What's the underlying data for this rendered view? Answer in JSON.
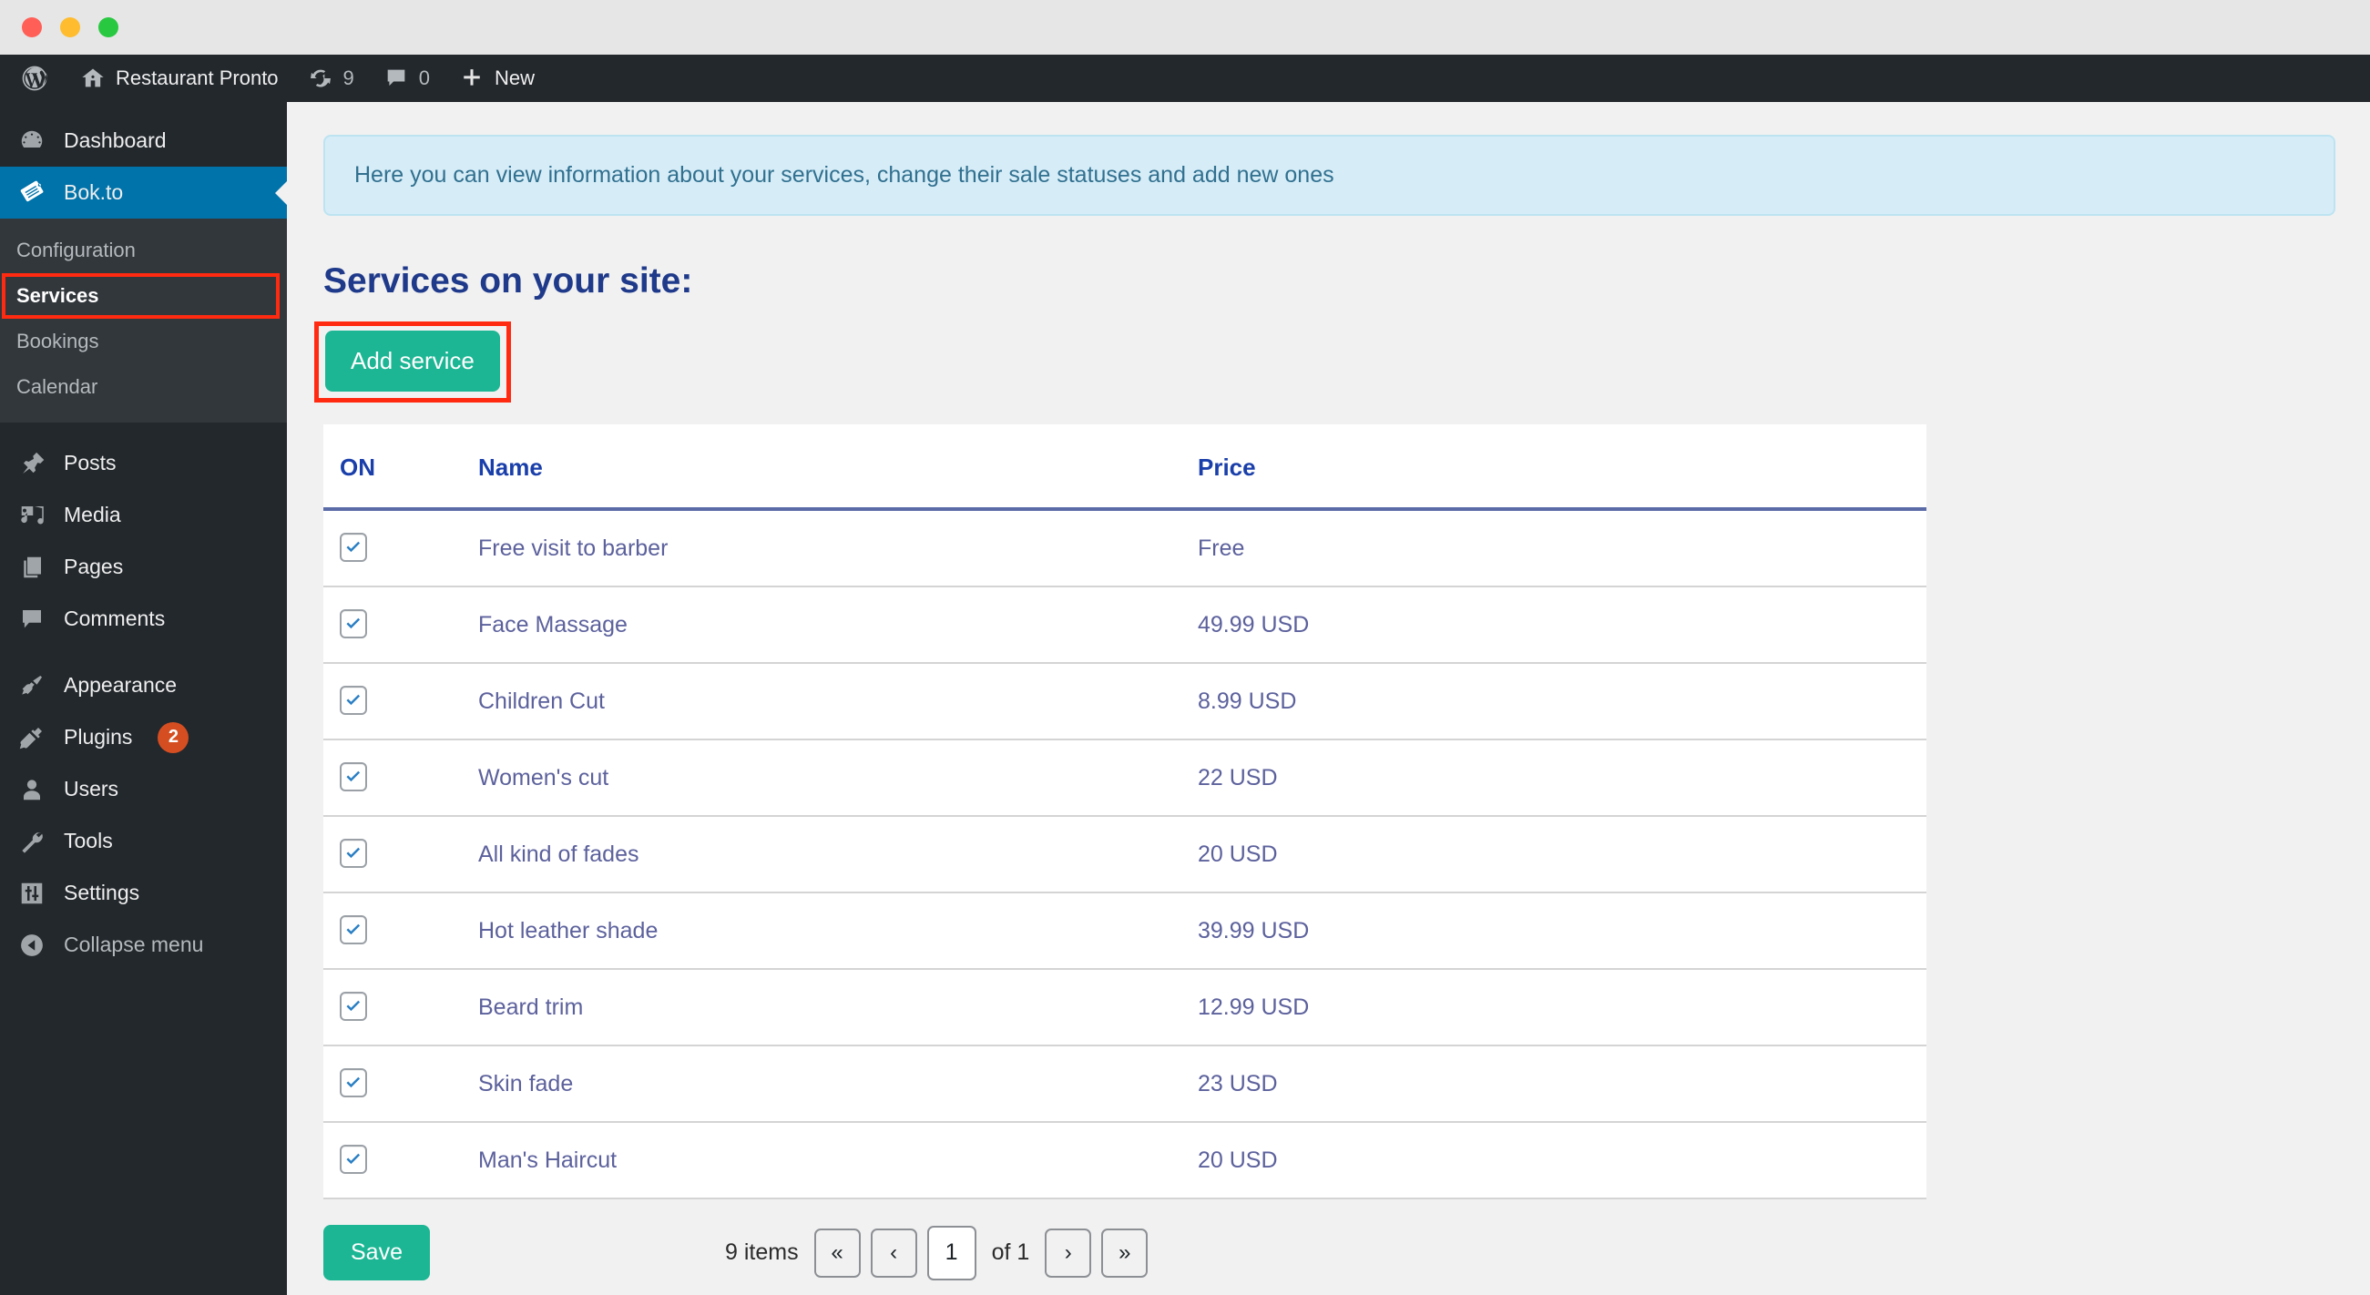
{
  "window": {
    "traffic_lights": [
      "close",
      "minimize",
      "zoom"
    ],
    "colors": {
      "close": "#ff5f57",
      "minimize": "#febc2e",
      "zoom": "#28c840"
    }
  },
  "adminbar": {
    "logo_icon": "wordpress-icon",
    "site_icon": "home-icon",
    "site_name": "Restaurant Pronto",
    "updates_icon": "updates-icon",
    "updates_count": "9",
    "comments_icon": "comment-icon",
    "comments_count": "0",
    "new_icon": "plus-icon",
    "new_label": "New"
  },
  "sidebar": {
    "items": [
      {
        "label": "Dashboard",
        "icon": "dashboard-icon",
        "active": false
      },
      {
        "label": "Bok.to",
        "icon": "bokto-tickets-icon",
        "active": true
      },
      {
        "label": "Posts",
        "icon": "pin-icon",
        "active": false
      },
      {
        "label": "Media",
        "icon": "media-icon",
        "active": false
      },
      {
        "label": "Pages",
        "icon": "pages-icon",
        "active": false
      },
      {
        "label": "Comments",
        "icon": "comment-icon",
        "active": false
      },
      {
        "label": "Appearance",
        "icon": "paintbrush-icon",
        "active": false
      },
      {
        "label": "Plugins",
        "icon": "plug-icon",
        "active": false,
        "badge": "2"
      },
      {
        "label": "Users",
        "icon": "user-icon",
        "active": false
      },
      {
        "label": "Tools",
        "icon": "wrench-icon",
        "active": false
      },
      {
        "label": "Settings",
        "icon": "sliders-icon",
        "active": false
      }
    ],
    "submenu": [
      {
        "label": "Configuration",
        "current": false,
        "highlighted": false
      },
      {
        "label": "Services",
        "current": true,
        "highlighted": true
      },
      {
        "label": "Bookings",
        "current": false,
        "highlighted": false
      },
      {
        "label": "Calendar",
        "current": false,
        "highlighted": false
      }
    ],
    "collapse": {
      "label": "Collapse menu",
      "icon": "collapse-arrow-icon"
    },
    "colors": {
      "active_bg": "#0073aa",
      "submenu_bg": "#32373c",
      "bg": "#23282d",
      "badge": "#d54e21"
    }
  },
  "main": {
    "notice": "Here you can view information about your services, change their sale statuses and add new ones",
    "page_title": "Services on your site:",
    "add_service_label": "Add service",
    "highlight_color": "#ff2a10",
    "accent_green": "#1cb694",
    "table": {
      "headers": [
        "ON",
        "Name",
        "Price"
      ],
      "rows": [
        {
          "on": true,
          "name": "Free visit to barber",
          "price": "Free"
        },
        {
          "on": true,
          "name": "Face Massage",
          "price": "49.99 USD"
        },
        {
          "on": true,
          "name": "Children Cut",
          "price": "8.99 USD"
        },
        {
          "on": true,
          "name": "Women's cut",
          "price": "22 USD"
        },
        {
          "on": true,
          "name": "All kind of fades",
          "price": "20 USD"
        },
        {
          "on": true,
          "name": "Hot leather shade",
          "price": "39.99 USD"
        },
        {
          "on": true,
          "name": "Beard trim",
          "price": "12.99 USD"
        },
        {
          "on": true,
          "name": "Skin fade",
          "price": "23 USD"
        },
        {
          "on": true,
          "name": "Man's Haircut",
          "price": "20 USD"
        }
      ]
    },
    "footer": {
      "save_label": "Save",
      "items_label": "9 items",
      "first_label": "«",
      "prev_label": "‹",
      "page_value": "1",
      "of_label": "of 1",
      "next_label": "›",
      "last_label": "»"
    }
  }
}
